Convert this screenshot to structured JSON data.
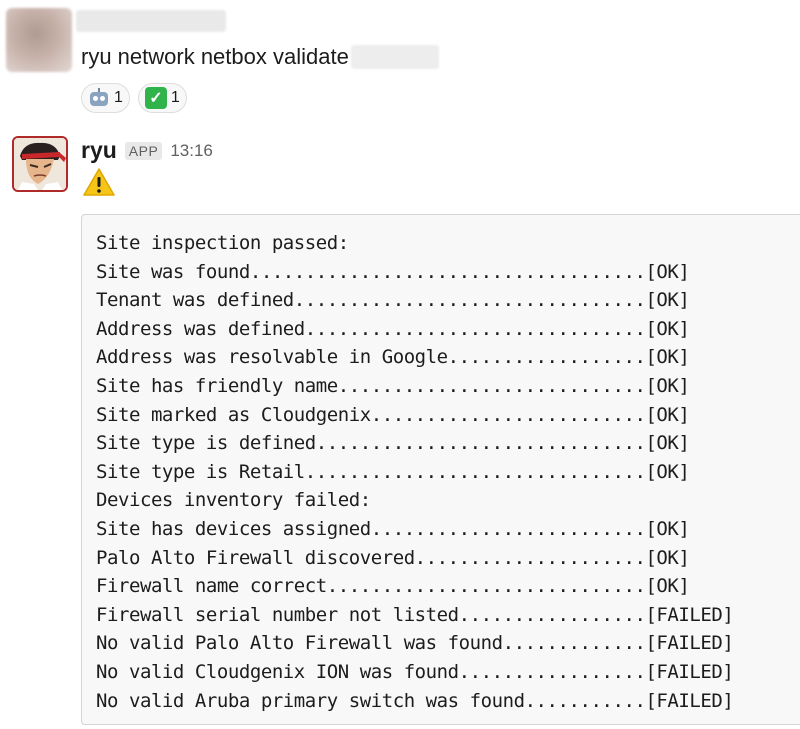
{
  "message1": {
    "command": "ryu network netbox validate",
    "reactions": [
      {
        "icon": "robot-face-icon",
        "count": "1"
      },
      {
        "icon": "white-check-mark-icon",
        "count": "1"
      }
    ]
  },
  "message2": {
    "author": "ryu",
    "badge": "APP",
    "time": "13:16",
    "emoji": "warning-icon",
    "code_lines": [
      "Site inspection passed:",
      "Site was found....................................[OK]",
      "Tenant was defined................................[OK]",
      "Address was defined...............................[OK]",
      "Address was resolvable in Google..................[OK]",
      "Site has friendly name............................[OK]",
      "Site marked as Cloudgenix.........................[OK]",
      "Site type is defined..............................[OK]",
      "Site type is Retail...............................[OK]",
      "Devices inventory failed:",
      "Site has devices assigned.........................[OK]",
      "Palo Alto Firewall discovered.....................[OK]",
      "Firewall name correct.............................[OK]",
      "Firewall serial number not listed.................[FAILED]",
      "No valid Palo Alto Firewall was found.............[FAILED]",
      "No valid Cloudgenix ION was found.................[FAILED]",
      "No valid Aruba primary switch was found...........[FAILED]"
    ]
  },
  "colors": {
    "badge_bg": "#e8e8e8",
    "avatar_border": "#b02a2a",
    "check_green": "#2fb34a",
    "warning_yellow": "#f5c518"
  }
}
